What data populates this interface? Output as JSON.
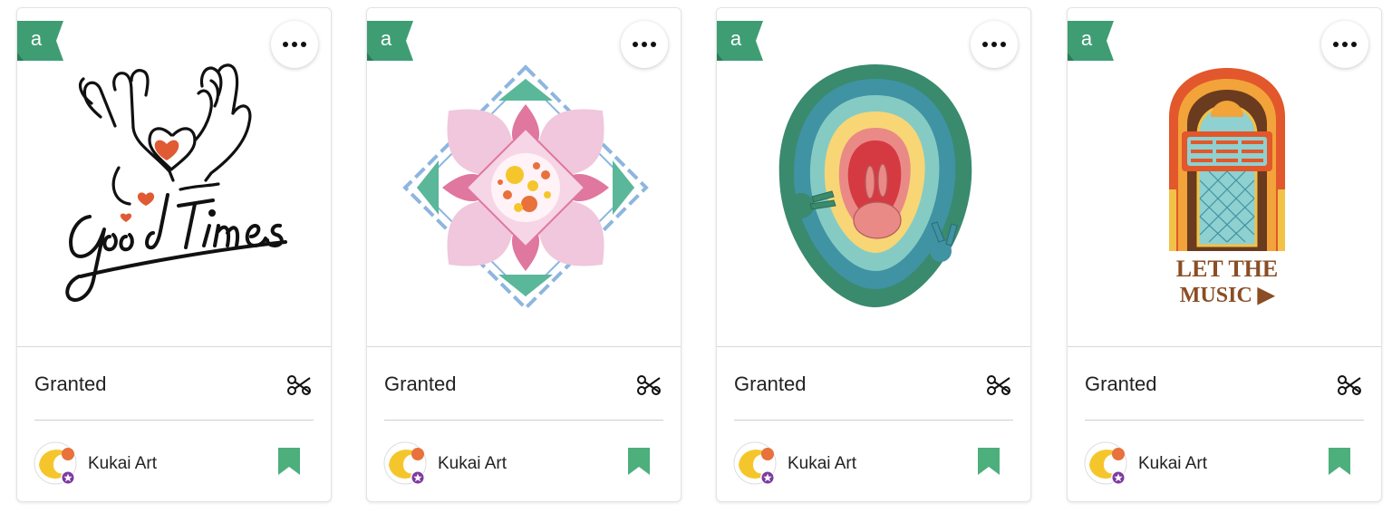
{
  "cards": [
    {
      "title_art": "good-times",
      "art_text": "Good Times",
      "status": "Granted",
      "author": "Kukai Art",
      "badge_letter": "a"
    },
    {
      "title_art": "mandala-diamond",
      "status": "Granted",
      "author": "Kukai Art",
      "badge_letter": "a"
    },
    {
      "title_art": "rainbow-bunnies",
      "status": "Granted",
      "author": "Kukai Art",
      "badge_letter": "a"
    },
    {
      "title_art": "jukebox",
      "art_text_line1": "LET THE",
      "art_text_line2": "MUSIC ▶",
      "status": "Granted",
      "author": "Kukai Art",
      "badge_letter": "a"
    }
  ],
  "colors": {
    "badge_green": "#3f9d73",
    "bookmark_green": "#4caf7c",
    "avatar_yellow": "#f5c62c",
    "avatar_orange": "#e8713c",
    "avatar_purple": "#7d3aa0"
  },
  "icons": {
    "more": "ellipsis-icon",
    "cut": "scissors-icon",
    "save": "bookmark-icon",
    "badge": "a-letter-badge-icon"
  }
}
